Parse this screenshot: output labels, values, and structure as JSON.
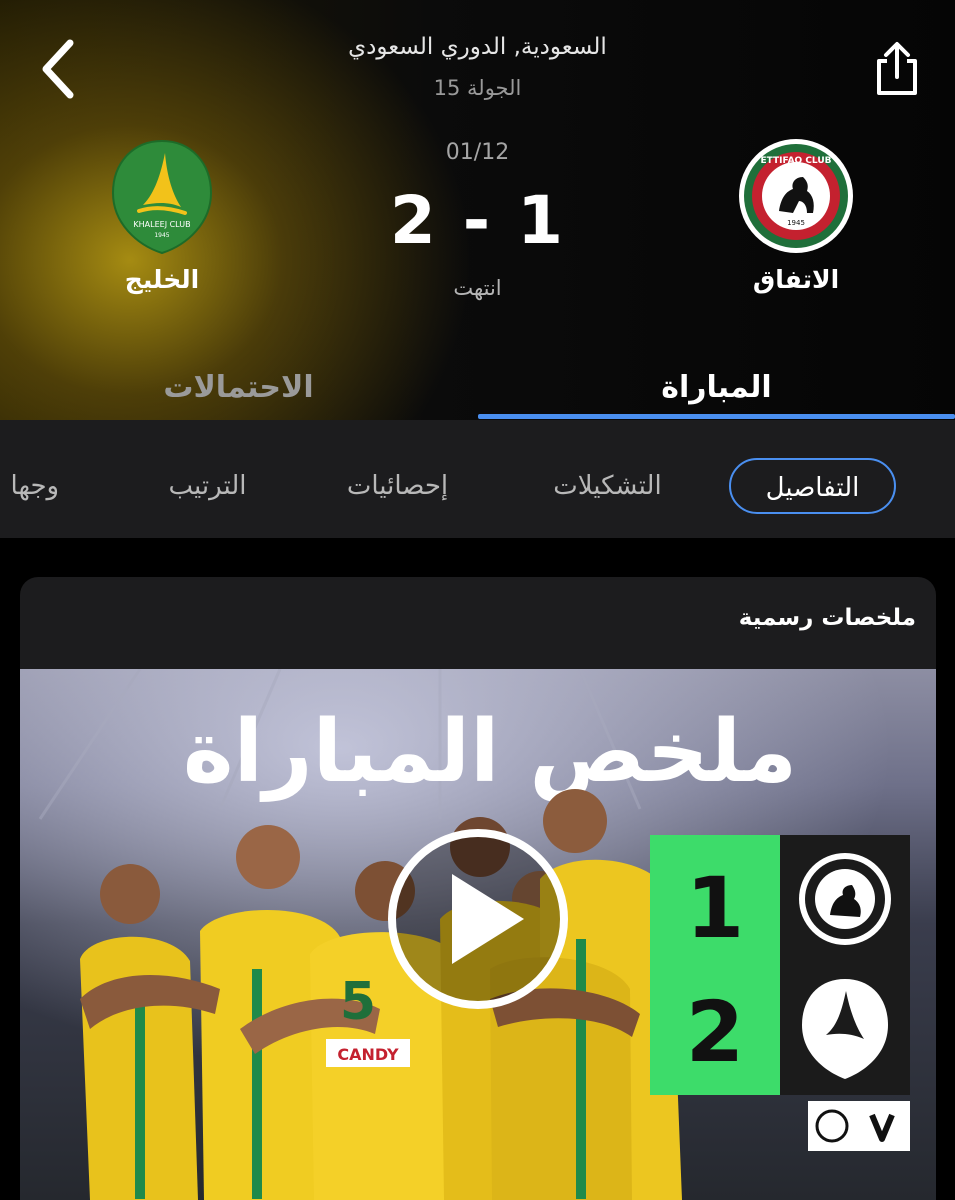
{
  "header": {
    "competition": "السعودية, الدوري السعودي",
    "round": "الجولة 15",
    "date": "01/12",
    "score": "2 - 1",
    "status": "انتهت",
    "home_team": {
      "name": "الاتفاق"
    },
    "away_team": {
      "name": "الخليج"
    }
  },
  "top_tabs": {
    "match": "المباراة",
    "odds": "الاحتمالات",
    "active": "المباراة"
  },
  "sub_tabs": {
    "items": [
      "التفاصيل",
      "التشكيلات",
      "إحصائيات",
      "الترتيب",
      "وجها لو"
    ],
    "active": "التفاصيل"
  },
  "highlights": {
    "title": "ملخصات رسمية",
    "thumbnail": {
      "headline": "ملخص المباراة",
      "home_score": "1",
      "away_score": "2",
      "jersey_number": "5",
      "home_logo_text": "ETTIFAQ CLUB",
      "away_logo_text": "KHALEEJ CLUB",
      "sponsor_text": "CANDY"
    }
  },
  "colors": {
    "accent": "#4a8ff0",
    "panel": "#1c1c1e",
    "khaleej_green": "#2e8b3a",
    "khaleej_yellow": "#f2c21a",
    "ettifaq_red": "#c4212f",
    "ettifaq_green": "#1f6f3a",
    "thumbnail_green": "#3ddc6a"
  },
  "icons": [
    "chevron-left-icon",
    "share-icon",
    "play-icon"
  ]
}
